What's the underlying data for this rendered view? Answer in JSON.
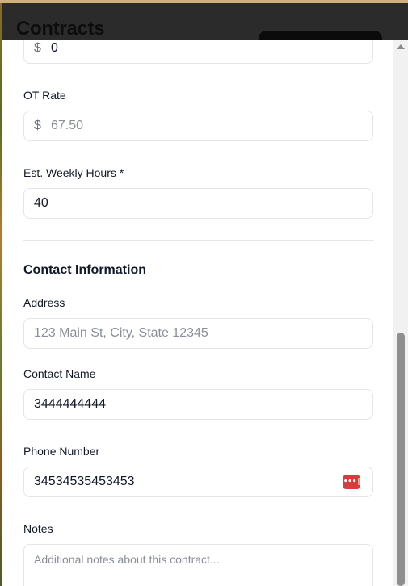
{
  "app": {
    "title": "Contracts"
  },
  "form": {
    "rate": {
      "currency": "$",
      "value": "0"
    },
    "ot_rate": {
      "label": "OT Rate",
      "currency": "$",
      "placeholder": "67.50"
    },
    "weekly_hours": {
      "label": "Est. Weekly Hours *",
      "value": "40"
    },
    "contact_section": {
      "title": "Contact Information"
    },
    "address": {
      "label": "Address",
      "placeholder": "123 Main St, City, State 12345"
    },
    "contact_name": {
      "label": "Contact Name",
      "value": "3444444444"
    },
    "phone": {
      "label": "Phone Number",
      "value": "34534535453453",
      "icon": "password-manager-icon",
      "icon_glyph": "•••|"
    },
    "notes": {
      "label": "Notes",
      "placeholder": "Additional notes about this contract..."
    }
  },
  "colors": {
    "accent_icon": "#d93a3a",
    "header_bg": "#2b2b2b",
    "border": "#e3e5ea"
  }
}
